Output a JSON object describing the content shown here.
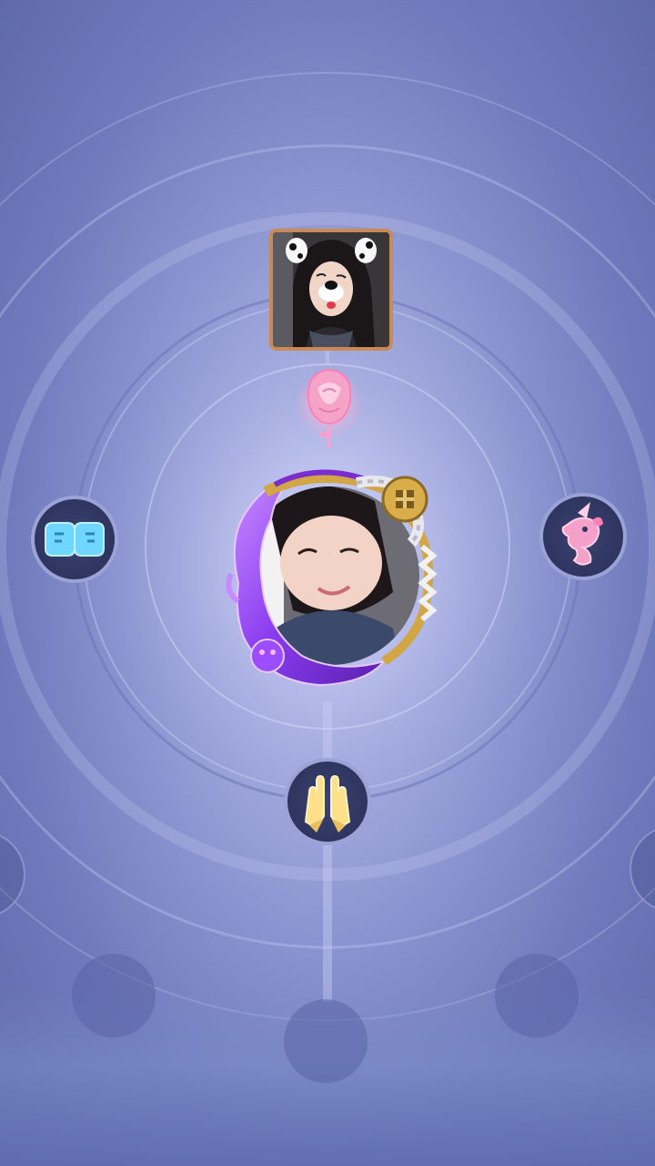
{
  "scene": {
    "background_color": "#8a93cf",
    "accent_purple": "#8a3cf0",
    "accent_gold": "#d2a545",
    "accent_pink": "#f5a0c8",
    "accent_cyan": "#6fd6ff"
  },
  "top_player": {
    "avatar": "player-photo-with-dog-filter"
  },
  "gift": {
    "icon": "rose-icon",
    "color": "#f6a3c8"
  },
  "center_player": {
    "avatar": "player-photo-center",
    "frame": "purple-flame-dragon-frame"
  },
  "actions": [
    {
      "id": "fist-bump",
      "icon": "fist-bump-icon",
      "color": "#6fd6ff"
    },
    {
      "id": "unicorn",
      "icon": "unicorn-icon",
      "color": "#f5a0c8"
    },
    {
      "id": "high-five",
      "icon": "high-five-icon",
      "color": "#ffe08a"
    }
  ],
  "empty_slots": [
    {
      "id": "slot-left"
    },
    {
      "id": "slot-center"
    },
    {
      "id": "slot-right"
    }
  ]
}
